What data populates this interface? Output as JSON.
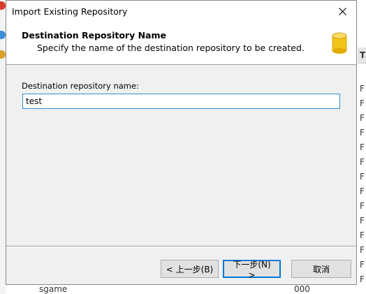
{
  "dialog": {
    "title": "Import Existing Repository",
    "header": {
      "title": "Destination Repository Name",
      "subtitle": "Specify the name of the destination repository to be created."
    },
    "field": {
      "label": "Destination repository name:",
      "value": "test"
    },
    "buttons": {
      "back": "< 上一步(B)",
      "next": "下一步(N) >",
      "cancel": "取消"
    }
  },
  "background": {
    "right_header_char": "T",
    "right_row_chars": [
      "F",
      "F",
      "F",
      "F",
      "F",
      "F",
      "F",
      "F",
      "F",
      "F",
      "F",
      "F",
      "F",
      "F"
    ],
    "bottom_text": "sgame",
    "bottom_number": "000"
  },
  "colors": {
    "accent": "#0078d7",
    "db_icon": "#f0c419"
  }
}
